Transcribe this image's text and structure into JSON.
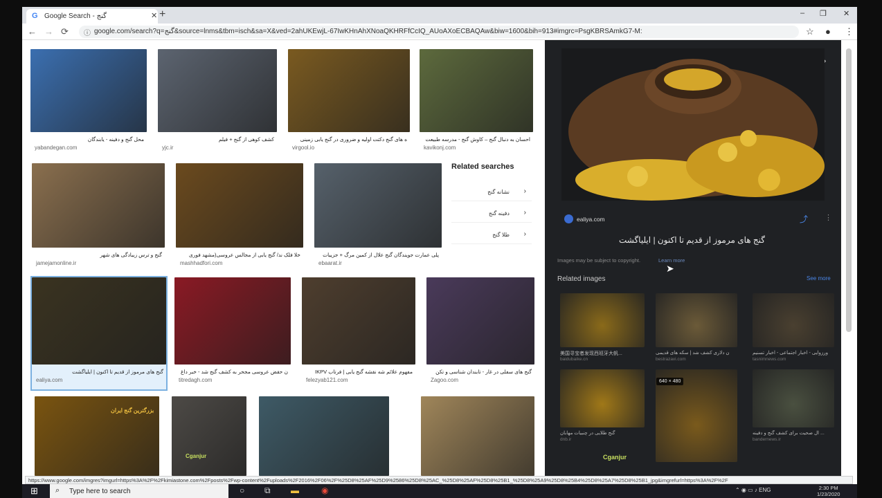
{
  "browser": {
    "tab_title": "Google Search - گنج",
    "tab_favicon": "G",
    "url": "google.com/search?q=گنج&source=lnms&tbm=isch&sa=X&ved=2ahUKEwjL-67IwKHnAhXNoaQKHRFfCcIQ_AUoAXoECBAQAw&biw=1600&bih=913#imgrc=PsgKBRSAmkG7-M:",
    "status_url": "https://www.google.com/imgres?imgurl=https%3A%2F%2Fkimiastone.com%2Fposts%2Fwp-content%2Fuploads%2F2016%2F06%2F%25D8%25AF%25D9%2586%25D8%25AC_%25D8%25AF%25D8%25B1_%25D8%25A9%25D8%25B4%25D8%25A7%25D8%25B1_jpg&imgrefurl=https%3A%2F%2F"
  },
  "icons": {
    "back": "←",
    "forward": "→",
    "reload": "⟳",
    "info": "ⓘ",
    "star": "☆",
    "profile": "●",
    "menu": "⋮",
    "close": "✕",
    "prev": "‹",
    "next": "›",
    "share": "⤴",
    "more": "⋮",
    "arrow": "›",
    "minimize": "–",
    "maximize": "❐",
    "newtab": "+",
    "windows": "⊞",
    "search": "⌕",
    "cursor": "➤"
  },
  "results": [
    {
      "caption": "محل گنج و دفینه - یابندگان",
      "source": "yabandegan.com",
      "color": "#3b6fb0"
    },
    {
      "caption": "کشف کوهی از گنج + فیلم",
      "source": "yjc.ir",
      "color": "#5c6470"
    },
    {
      "caption": "ه های گنج دکتت اولیه و ضروری در گنج یابی زمینی",
      "source": "virgool.io",
      "color": "#7a5a20"
    },
    {
      "caption": "احسان به دنبال گنج – کاوش گنج - مدرسه طبیعت",
      "source": "kavikonj.com",
      "color": "#5d6a3d"
    },
    {
      "caption": "گنج و ترس زیبادگی های شهر",
      "source": "jamejamonline.ir",
      "color": "#8a6f4e"
    },
    {
      "caption": "خلا فلک ند/ گنج یابی از مجالس عروسی(مشهد فوری",
      "source": "mashhadfori.com",
      "color": "#6b4a1e"
    },
    {
      "caption": "پلی عمارت جویندگان گنج علال از کمین مرگ + جزییات",
      "source": "ebaarat.ir",
      "color": "#56616b"
    },
    {
      "caption": "گنج های مرموز از قدیم تا اکنون | ایلیاگشت",
      "source": "ealiya.com",
      "color": "#3a3320"
    },
    {
      "caption": "ن حقض عروسی مجحر به کشف گنج شد - خبر داغ",
      "source": "titredagh.com",
      "color": "#8a1a24"
    },
    {
      "caption": "IKPV مفهوم علائم شه نقشه گنج یابی | فرتاب",
      "source": "felezyab121.com",
      "color": "#4e3e2e"
    },
    {
      "caption": "گنج های سفلی در غار - تابندان شناسی و تکن",
      "source": "Zagoo.com",
      "color": "#4a3a5a"
    },
    {
      "caption": "",
      "source": "",
      "color": "#7a5410"
    },
    {
      "caption": "",
      "source": "",
      "color": "#4d4a46"
    },
    {
      "caption": "",
      "source": "",
      "color": "#3e5a66"
    },
    {
      "caption": "",
      "source": "",
      "color": "#a0865a"
    }
  ],
  "tile_texts": {
    "t12": "بزرگترین گنج ایران",
    "t13": "Cganjur"
  },
  "related_searches": {
    "title": "Related searches",
    "items": [
      "نشانه گنج",
      "دفینه گنج",
      "طلا گنج"
    ]
  },
  "panel": {
    "site": "ealiya.com",
    "title": "گنج های مرموز از قدیم تا اکنون | ایلیاگشت",
    "copyright": "Images may be subject to copyright.",
    "learn_more": "Learn more",
    "related_heading": "Related images",
    "see_more": "See more",
    "badge": "640 × 480",
    "related": [
      {
        "caption": "美国寻宝者发现西班牙大帆...",
        "source": "baidubaike.cn",
        "color": "#8a6a1a"
      },
      {
        "caption": "ن دلاری کشف شد | سکه های قدیمی",
        "source": "bestrazavi.com",
        "color": "#6b5a38"
      },
      {
        "caption": "ورزوایی - اخبار اجتماعی - اخبار تسنیم",
        "source": "tasnimnews.com",
        "color": "#4a4030"
      },
      {
        "caption": "گنج طلایی در چنبیات مهابان",
        "source": "dnb.ir",
        "color": "#a07818"
      },
      {
        "caption": "",
        "source": "",
        "color": "#7a5a1c"
      },
      {
        "caption": "ال صحیت برای کشف گنج و دفینه ...",
        "source": "bandernews.ir",
        "color": "#4a5040"
      }
    ],
    "watermark": "Cganjur"
  },
  "taskbar": {
    "search_placeholder": "Type here to search",
    "time": "2:30 PM",
    "date": "1/23/2020",
    "lang": "ENG"
  }
}
